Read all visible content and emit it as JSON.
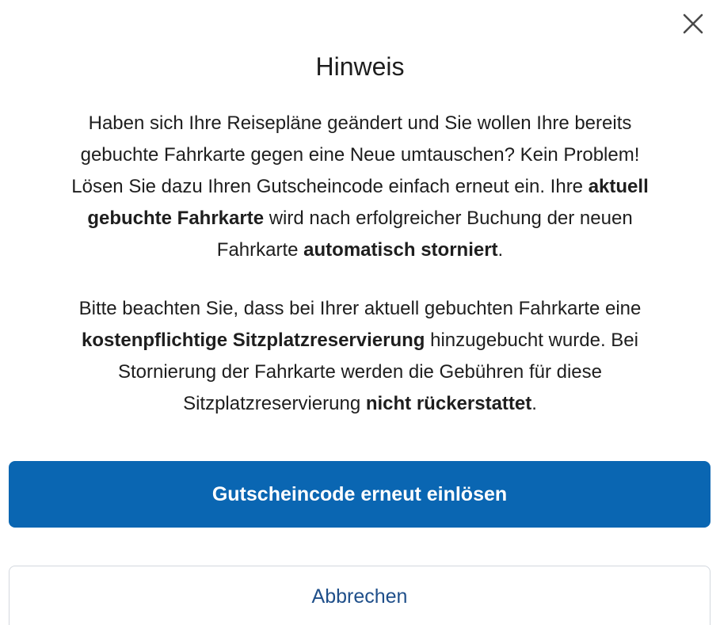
{
  "dialog": {
    "close_icon": "close-icon",
    "title": "Hinweis",
    "paragraph1": {
      "line1": "Haben sich Ihre Reisepläne geändert und Sie wollen Ihre bereits",
      "line2": "gebuchte Fahrkarte gegen eine Neue umtauschen? Kein Problem!",
      "line3_pre": "Lösen Sie dazu Ihren Gutscheincode einfach erneut ein. Ihre ",
      "line3_bold": "aktuell",
      "line4_bold": "gebuchte Fahrkarte",
      "line4_post": " wird nach erfolgreicher Buchung der neuen",
      "line5_pre": "Fahrkarte ",
      "line5_bold": "automatisch storniert",
      "line5_post": "."
    },
    "paragraph2": {
      "line1": "Bitte beachten Sie, dass bei Ihrer aktuell gebuchten Fahrkarte eine",
      "line2_bold": "kostenpflichtige Sitzplatzreservierung",
      "line2_post": " hinzugebucht wurde. Bei",
      "line3": "Stornierung der Fahrkarte werden die Gebühren für diese",
      "line4_pre": "Sitzplatzreservierung ",
      "line4_bold": "nicht rückerstattet",
      "line4_post": "."
    },
    "primary_button_label": "Gutscheincode erneut einlösen",
    "secondary_button_label": "Abbrechen",
    "colors": {
      "primary": "#0a66b2",
      "secondary_text": "#1f4f8a",
      "border": "#d3d8de"
    }
  }
}
